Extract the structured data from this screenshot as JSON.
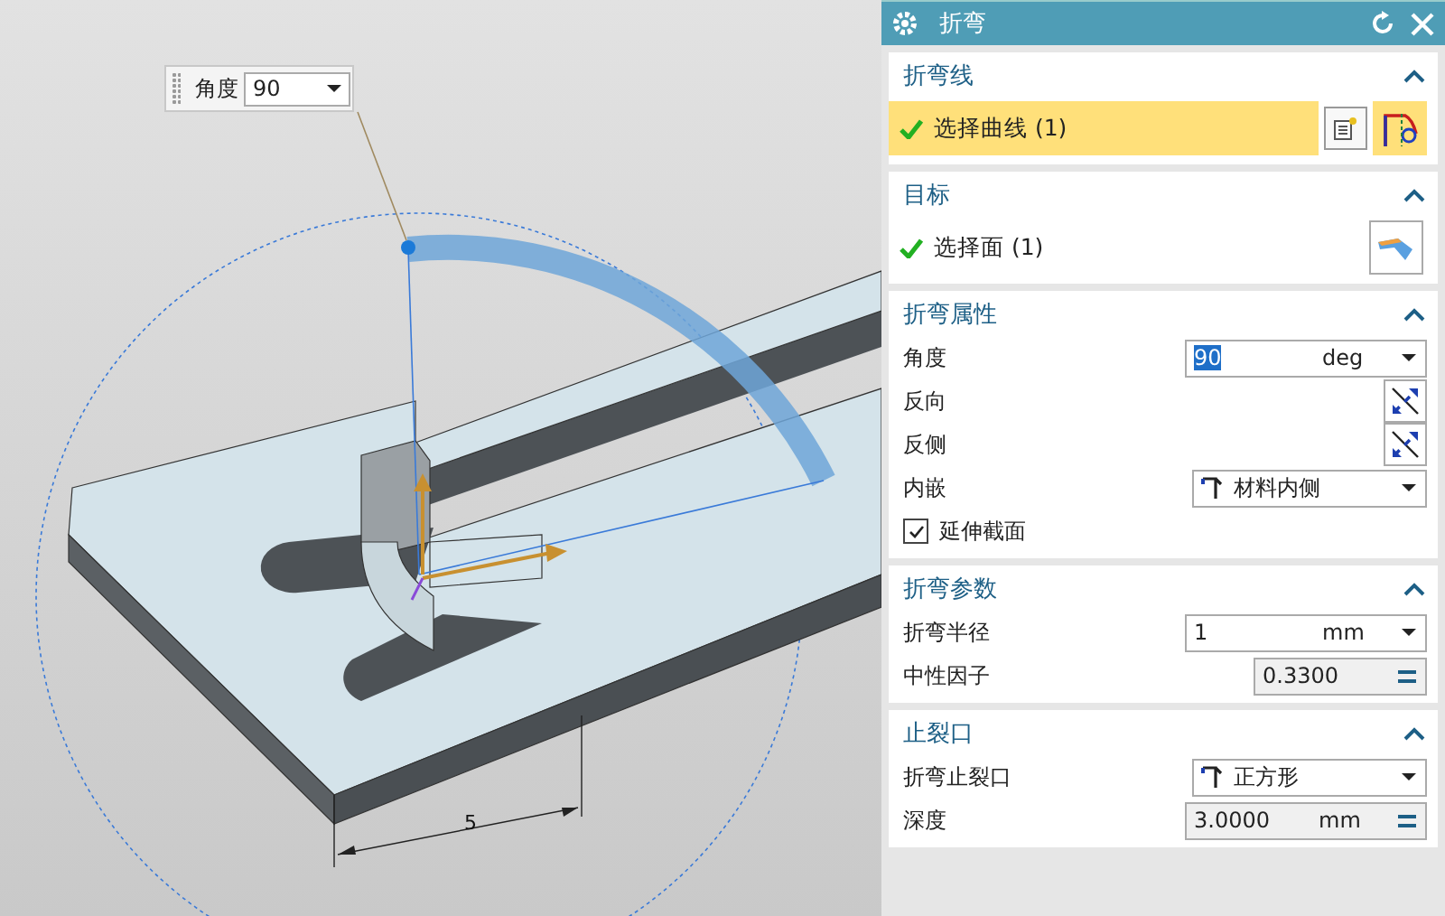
{
  "viewport": {
    "angle_widget": {
      "label": "角度",
      "value": "90"
    },
    "dimension": "5"
  },
  "panel": {
    "title": "折弯",
    "sections": [
      {
        "title": "折弯线",
        "expanded": true,
        "rows": [
          {
            "kind": "select",
            "label": "选择曲线 (1)",
            "active": true
          }
        ]
      },
      {
        "title": "目标",
        "expanded": true,
        "rows": [
          {
            "kind": "select",
            "label": "选择面 (1)",
            "active": false
          }
        ]
      },
      {
        "title": "折弯属性",
        "expanded": true,
        "rows": [
          {
            "kind": "input",
            "label": "角度",
            "value": "90",
            "unit": "deg",
            "value_selected": true
          },
          {
            "kind": "toggle",
            "label": "反向"
          },
          {
            "kind": "toggle",
            "label": "反侧"
          },
          {
            "kind": "dropdown",
            "label": "内嵌",
            "value": "材料内侧"
          },
          {
            "kind": "checkbox",
            "label": "延伸截面",
            "checked": true
          }
        ]
      },
      {
        "title": "折弯参数",
        "expanded": true,
        "rows": [
          {
            "kind": "input",
            "label": "折弯半径",
            "value": "1",
            "unit": "mm",
            "value_selected": false
          },
          {
            "kind": "formula",
            "label": "中性因子",
            "value": "0.3300"
          }
        ]
      },
      {
        "title": "止裂口",
        "expanded": true,
        "rows": [
          {
            "kind": "dropdown",
            "label": "折弯止裂口",
            "value": "正方形"
          },
          {
            "kind": "formula",
            "label": "深度",
            "value": "3.0000",
            "unit": "mm"
          }
        ]
      }
    ]
  }
}
